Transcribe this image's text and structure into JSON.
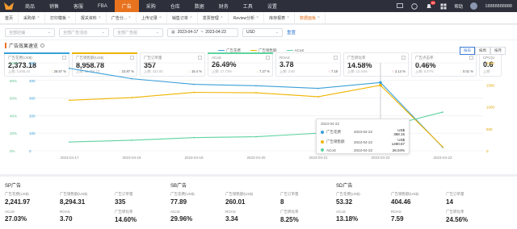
{
  "topnav": {
    "items": [
      "商品",
      "销售",
      "客服",
      "FBA",
      "广告",
      "采购",
      "仓库",
      "数据",
      "财务",
      "工具",
      "设置"
    ],
    "active_index": 4,
    "help": "帮助",
    "notif_count": "99",
    "username": "18888888888"
  },
  "subnav": {
    "items": [
      "首页",
      "采购单",
      "打印模板",
      "报关资料",
      "广告分...",
      "上传记录",
      "销售订单",
      "发票管理",
      "Review分析",
      "库存报表",
      "数据面板"
    ],
    "active_index": 10
  },
  "filters": {
    "shop_placeholder": "全部店铺",
    "campaign_placeholder": "全部广告活动",
    "group_placeholder": "全部广告组",
    "date_from": "2023-04-17",
    "date_sep": "~",
    "date_to": "2023-04-23",
    "currency": "USD",
    "query_label": "重置"
  },
  "panel": {
    "title": "广告效果速览",
    "cards": [
      {
        "label": "广告花费(US$)",
        "value": "2,373.18",
        "prev": "上期: 1,845.44",
        "change": "28.57 %",
        "dir": "down",
        "color": "#3aa0d8"
      },
      {
        "label": "广告销售额(US$)",
        "value": "8,958.78",
        "prev": "上期: 11,766.73",
        "change": "23.87 %",
        "dir": "down",
        "color": "#f0b400"
      },
      {
        "label": "广告订单量",
        "value": "357",
        "prev": "上期: 422.00",
        "change": "15.4 %",
        "dir": "down",
        "color": ""
      },
      {
        "label": "ACoS",
        "value": "26.49%",
        "prev": "上期: 17.73%",
        "change": "7.27 %",
        "dir": "down",
        "color": "#5fd3a0"
      },
      {
        "label": "ROAS",
        "value": "3.78",
        "prev": "上期: 3.60",
        "change": "7.18",
        "dir": "up",
        "color": ""
      },
      {
        "label": "广告转化率",
        "value": "14.58%",
        "prev": "上期: 12.44%",
        "change": "2.14 %",
        "dir": "up",
        "color": ""
      },
      {
        "label": "广告点击率",
        "value": "0.46%",
        "prev": "上期: 0.47%",
        "change": "0.01 %",
        "dir": "down",
        "color": ""
      },
      {
        "label": "CPC(U",
        "value": "0.6",
        "prev": "上期",
        "change": "",
        "dir": "",
        "color": ""
      }
    ],
    "segments": [
      "按日",
      "按周",
      "按月"
    ],
    "segment_active": 0
  },
  "chart_data": {
    "type": "line",
    "x": [
      "2023-04-17",
      "2023-04-18",
      "2023-04-19",
      "2023-04-20",
      "2023-04-21",
      "2023-04-22",
      "2023-04-23"
    ],
    "series": [
      {
        "name": "广告花费",
        "axis": "left",
        "color": "#3aa0d8",
        "values": [
          469,
          410,
          378,
          370,
          355,
          388.15,
          20
        ]
      },
      {
        "name": "广告销售额",
        "axis": "right",
        "color": "#f0b400",
        "values": [
          1150,
          1210,
          1330,
          1320,
          1230,
          1490.57,
          90
        ]
      },
      {
        "name": "ACoS",
        "axis": "pct",
        "color": "#5fd3a0",
        "values": [
          10,
          12,
          15,
          16,
          20,
          26.04,
          44
        ]
      }
    ],
    "left_ticks": [
      "500",
      "400",
      "300",
      "200",
      "100",
      "0"
    ],
    "right_ticks": [
      "2000",
      "1500",
      "1000",
      "500",
      "0"
    ],
    "pct_ticks": [
      "100%",
      "80%",
      "60%",
      "40%",
      "20%",
      "0%"
    ],
    "ylim_left": [
      0,
      500
    ],
    "ylim_right": [
      0,
      2000
    ],
    "ylim_pct": [
      0,
      100
    ],
    "grid": true,
    "legend": "top-center",
    "tooltip": {
      "title": "2023-04-22",
      "rows": [
        {
          "name": "广告花费",
          "date": "2023-04-22",
          "value": "US$ 388.15",
          "color": "#3aa0d8"
        },
        {
          "name": "广告销售额",
          "date": "2023-04-22",
          "value": "US$ 1490.57",
          "color": "#f0b400"
        },
        {
          "name": "ACoS",
          "date": "2023-04-22",
          "value": "26.04%",
          "color": "#5fd3a0"
        }
      ]
    }
  },
  "bottom": [
    {
      "title": "SP广告",
      "metrics": [
        {
          "label": "广告花费(US$)",
          "value": "2,241.97"
        },
        {
          "label": "广告销售额(US$)",
          "value": "8,294.31"
        },
        {
          "label": "广告订单量",
          "value": "335"
        },
        {
          "label": "ACoS",
          "value": "27.03%"
        },
        {
          "label": "ROAS",
          "value": "3.70"
        },
        {
          "label": "广告转化率",
          "value": "14.60%"
        }
      ]
    },
    {
      "title": "SB广告",
      "metrics": [
        {
          "label": "广告花费(US$)",
          "value": "77.89"
        },
        {
          "label": "广告销售额(US$)",
          "value": "260.01"
        },
        {
          "label": "广告订单量",
          "value": "8"
        },
        {
          "label": "ACoS",
          "value": "29.96%"
        },
        {
          "label": "ROAS",
          "value": "3.34"
        },
        {
          "label": "广告转化率",
          "value": "8.25%"
        }
      ]
    },
    {
      "title": "SD广告",
      "metrics": [
        {
          "label": "广告花费(US$)",
          "value": "53.32"
        },
        {
          "label": "广告销售额(US$)",
          "value": "404.46"
        },
        {
          "label": "广告订单量",
          "value": "14"
        },
        {
          "label": "ACoS",
          "value": "13.18%"
        },
        {
          "label": "ROAS",
          "value": "7.59"
        },
        {
          "label": "广告转化率",
          "value": "24.56%"
        }
      ]
    }
  ]
}
